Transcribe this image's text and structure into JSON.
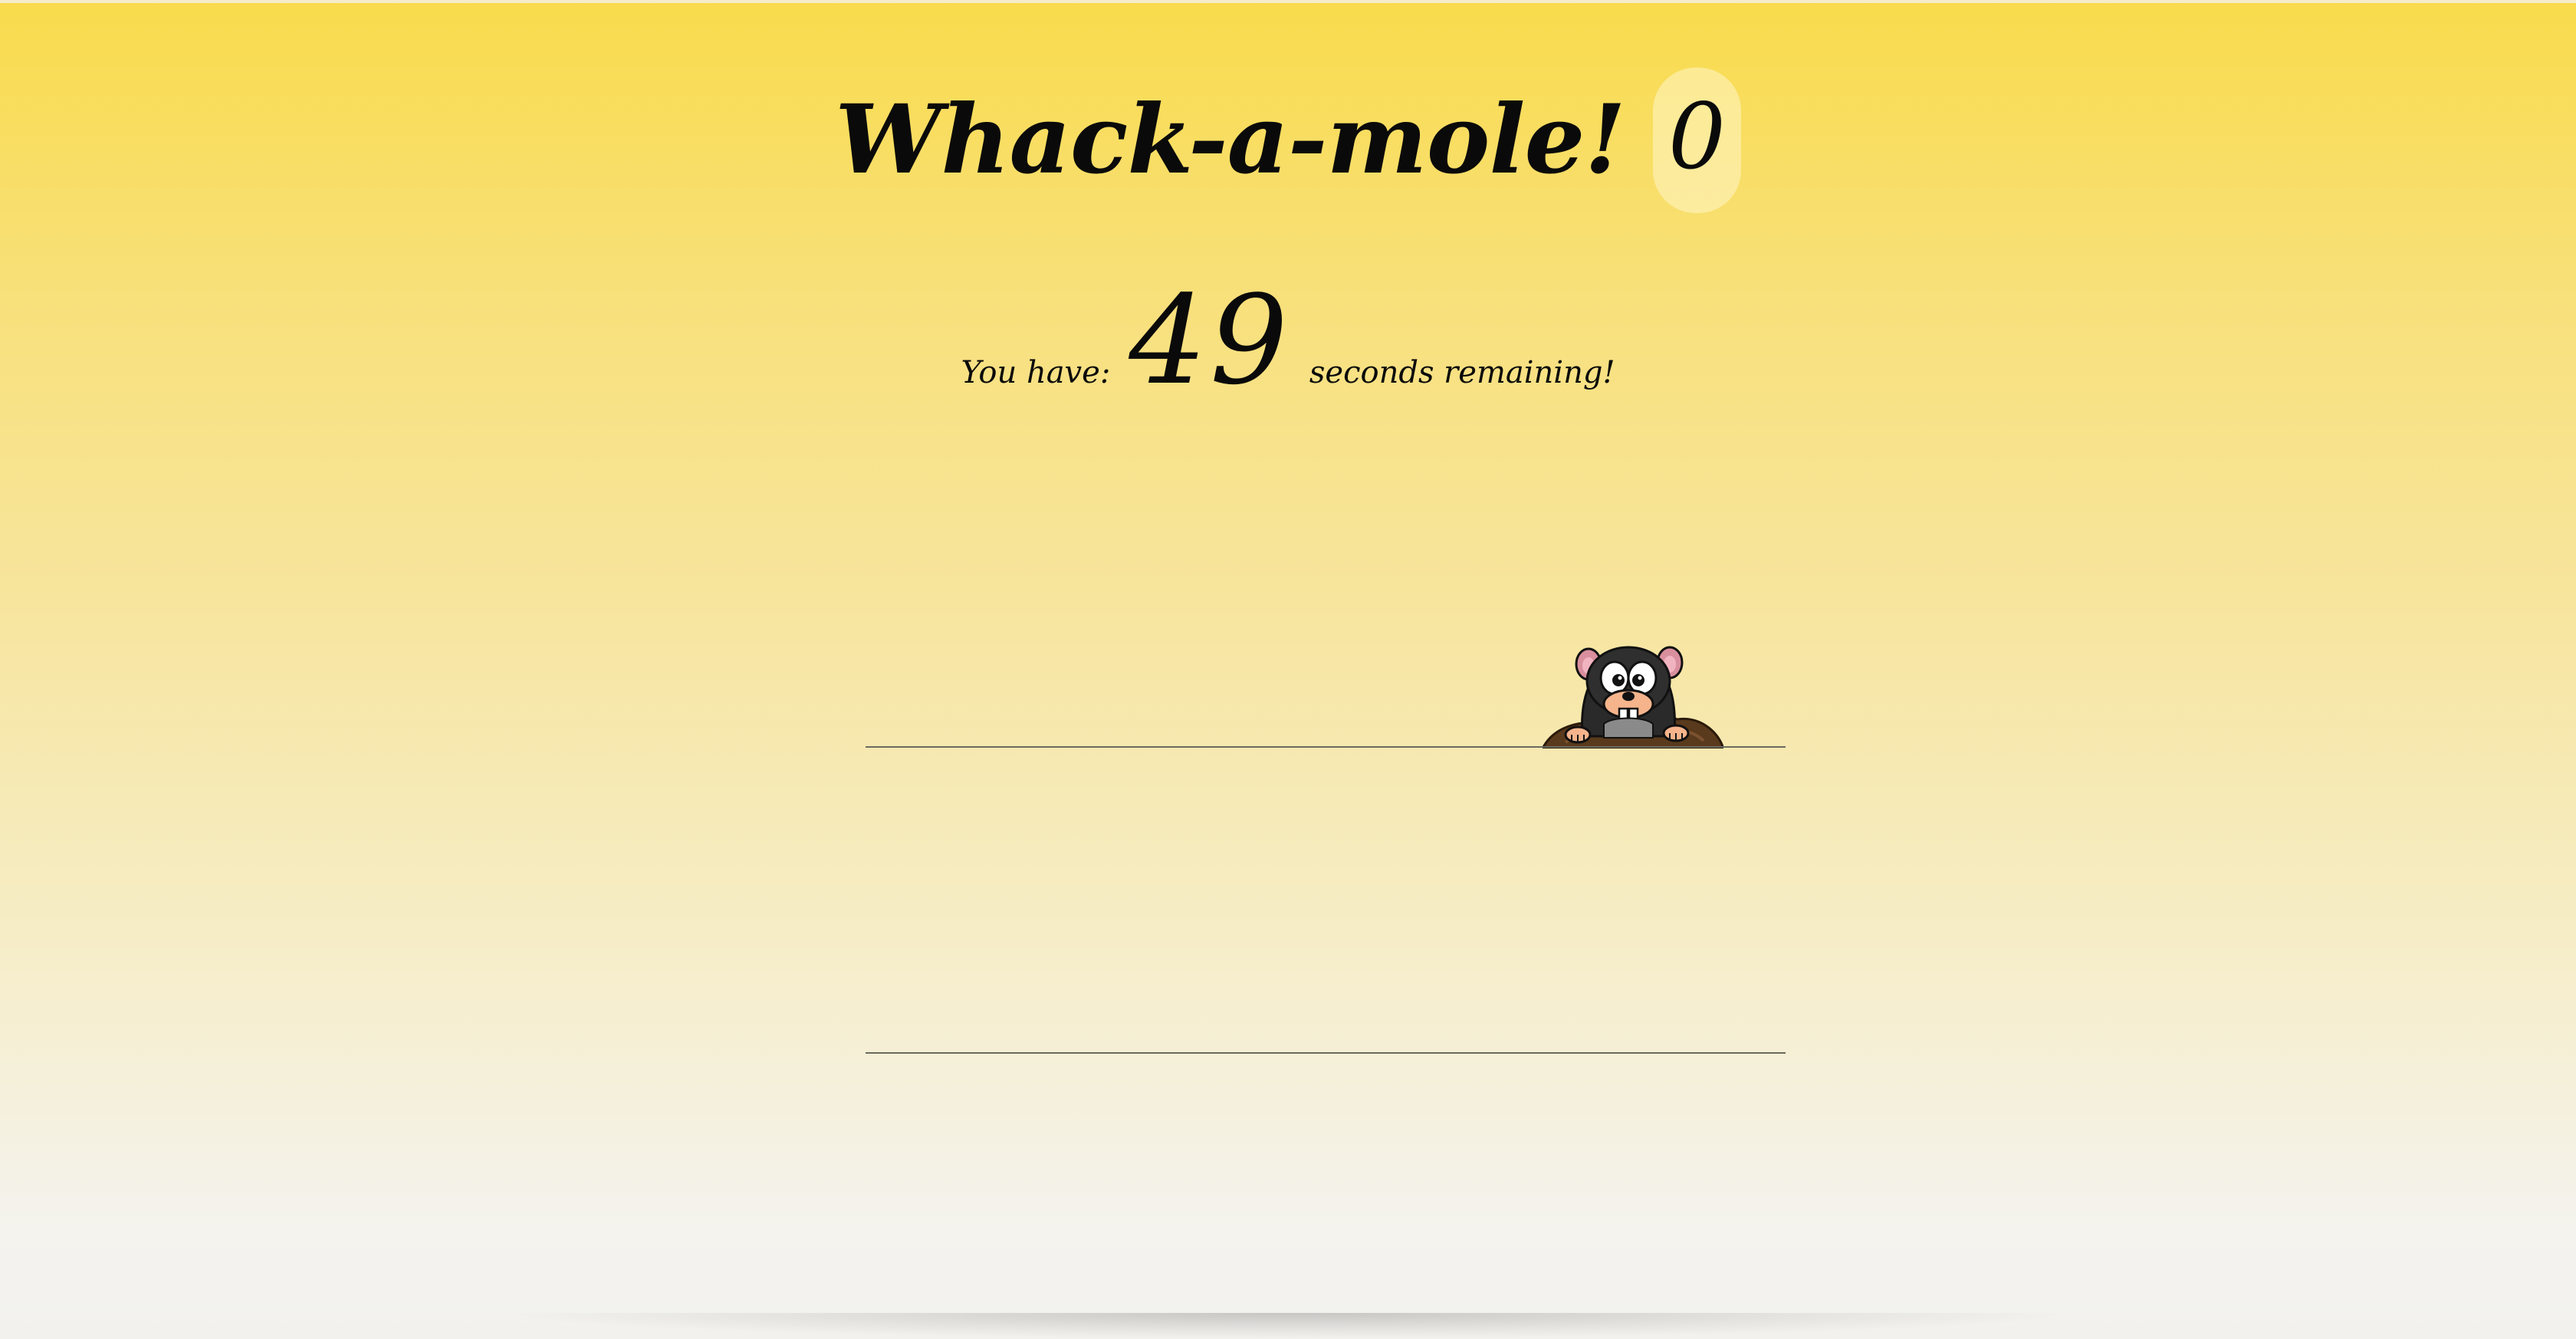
{
  "game": {
    "title": "Whack-a-mole!",
    "score": "0"
  },
  "timer": {
    "prefix": "You have:",
    "seconds": "49",
    "suffix": "seconds remaining!"
  },
  "board": {
    "rows": 2,
    "active_mole_icon": "mole-icon"
  },
  "colors": {
    "background_top": "#f9db4c",
    "background_bottom": "#f2f1ee",
    "ground_line": "#6a6a5e"
  }
}
